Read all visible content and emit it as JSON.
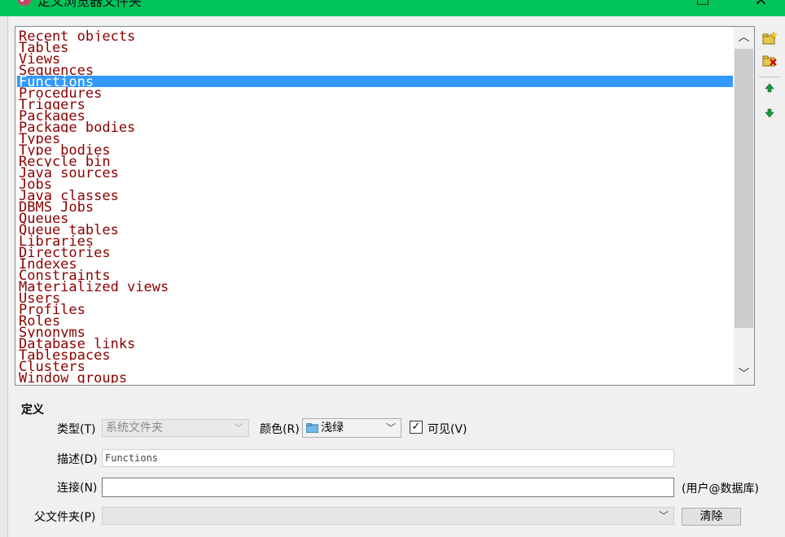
{
  "window": {
    "title": "定义浏览器文件夹"
  },
  "list": {
    "items": [
      "Recent objects",
      "Tables",
      "Views",
      "Sequences",
      "Functions",
      "Procedures",
      "Triggers",
      "Packages",
      "Package bodies",
      "Types",
      "Type bodies",
      "Recycle bin",
      "Java sources",
      "Jobs",
      "Java classes",
      "DBMS Jobs",
      "Queues",
      "Queue tables",
      "Libraries",
      "Directories",
      "Indexes",
      "Constraints",
      "Materialized views",
      "Users",
      "Profiles",
      "Roles",
      "Synonyms",
      "Database links",
      "Tablespaces",
      "Clusters",
      "Window groups"
    ],
    "selected_index": 4
  },
  "toolbar_icons": [
    "new-folder-icon",
    "delete-folder-icon",
    "move-up-icon",
    "move-down-icon"
  ],
  "definition": {
    "group_title": "定义",
    "type_label": "类型(T)",
    "type_value": "系统文件夹",
    "color_label": "颜色(R)",
    "color_value": "浅绿",
    "visible_label": "可见(V)",
    "visible_checked": true,
    "description_label": "描述(D)",
    "description_value": "Functions",
    "connection_label": "连接(N)",
    "connection_value": "",
    "connection_hint": "(用户@数据库)",
    "parent_label": "父文件夹(P)",
    "parent_value": "",
    "clear_button": "清除"
  },
  "colors": {
    "titlebar": "#00c35a",
    "selection": "#3399ff",
    "list_text": "#8b0000"
  }
}
